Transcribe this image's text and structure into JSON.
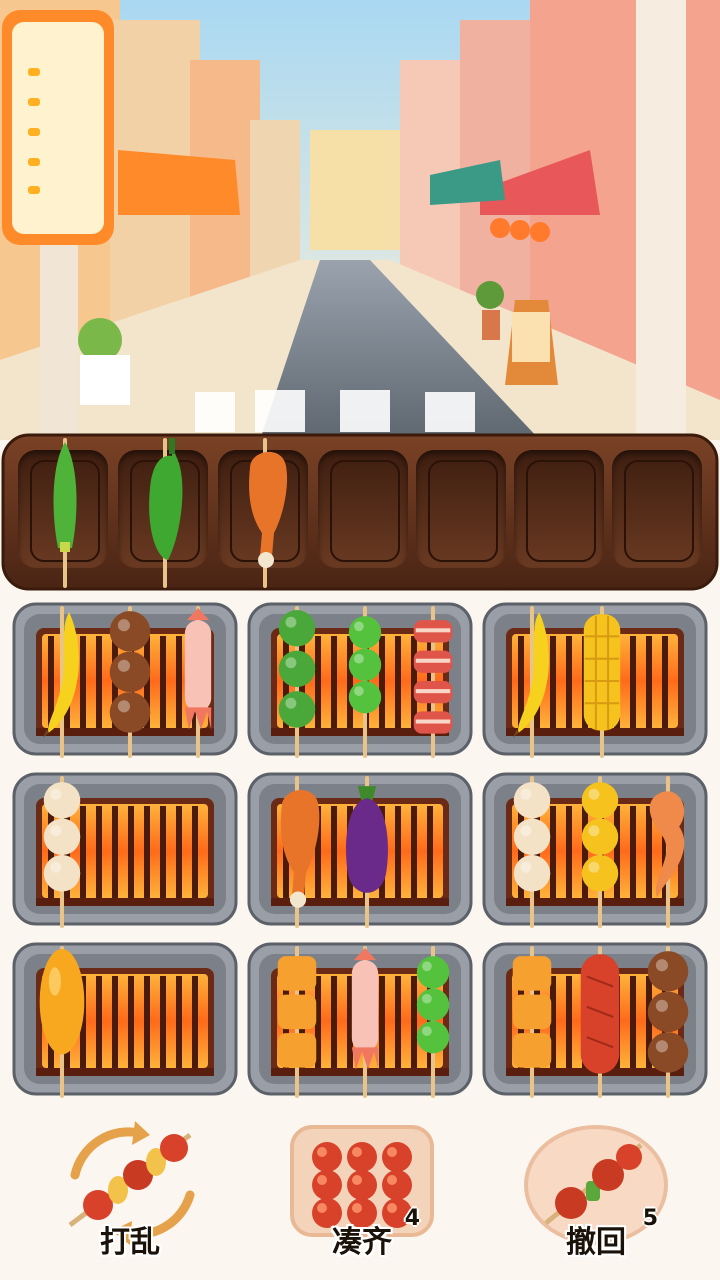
{
  "slots": [
    {
      "item": "okra-skewer"
    },
    {
      "item": "green-pepper-skewer"
    },
    {
      "item": "chicken-leg-skewer"
    },
    {
      "item": "empty"
    },
    {
      "item": "empty"
    },
    {
      "item": "empty"
    },
    {
      "item": "empty"
    }
  ],
  "grills": [
    {
      "items": [
        "banana-skewer",
        "mushroom-skewer",
        "squid-skewer"
      ]
    },
    {
      "items": [
        "broccoli-skewer",
        "edamame-skewer",
        "bacon-skewer"
      ]
    },
    {
      "items": [
        "banana-skewer",
        "corn-skewer"
      ]
    },
    {
      "items": [
        "dumpling-skewer"
      ]
    },
    {
      "items": [
        "chicken-leg-skewer",
        "eggplant-skewer"
      ]
    },
    {
      "items": [
        "dumpling-skewer",
        "corn-chunk-skewer",
        "shrimp-skewer"
      ]
    },
    {
      "items": [
        "mango-skewer"
      ]
    },
    {
      "items": [
        "tofu-skewer",
        "squid-skewer",
        "edamame-skewer"
      ]
    },
    {
      "items": [
        "tofu-skewer",
        "sausage-skewer",
        "mushroom-skewer"
      ]
    }
  ],
  "tools": {
    "shuffle": {
      "label": "打乱",
      "icon": "shuffle-skewer-icon"
    },
    "align": {
      "label": "凑齐",
      "count": "4",
      "icon": "meatball-tray-icon"
    },
    "undo": {
      "label": "撤回",
      "count": "5",
      "icon": "plate-skewer-icon"
    }
  },
  "colors": {
    "tray": "#5a2e1a",
    "grill_frame": "#8c8f96",
    "grill_fire": "#ff7a1a"
  }
}
